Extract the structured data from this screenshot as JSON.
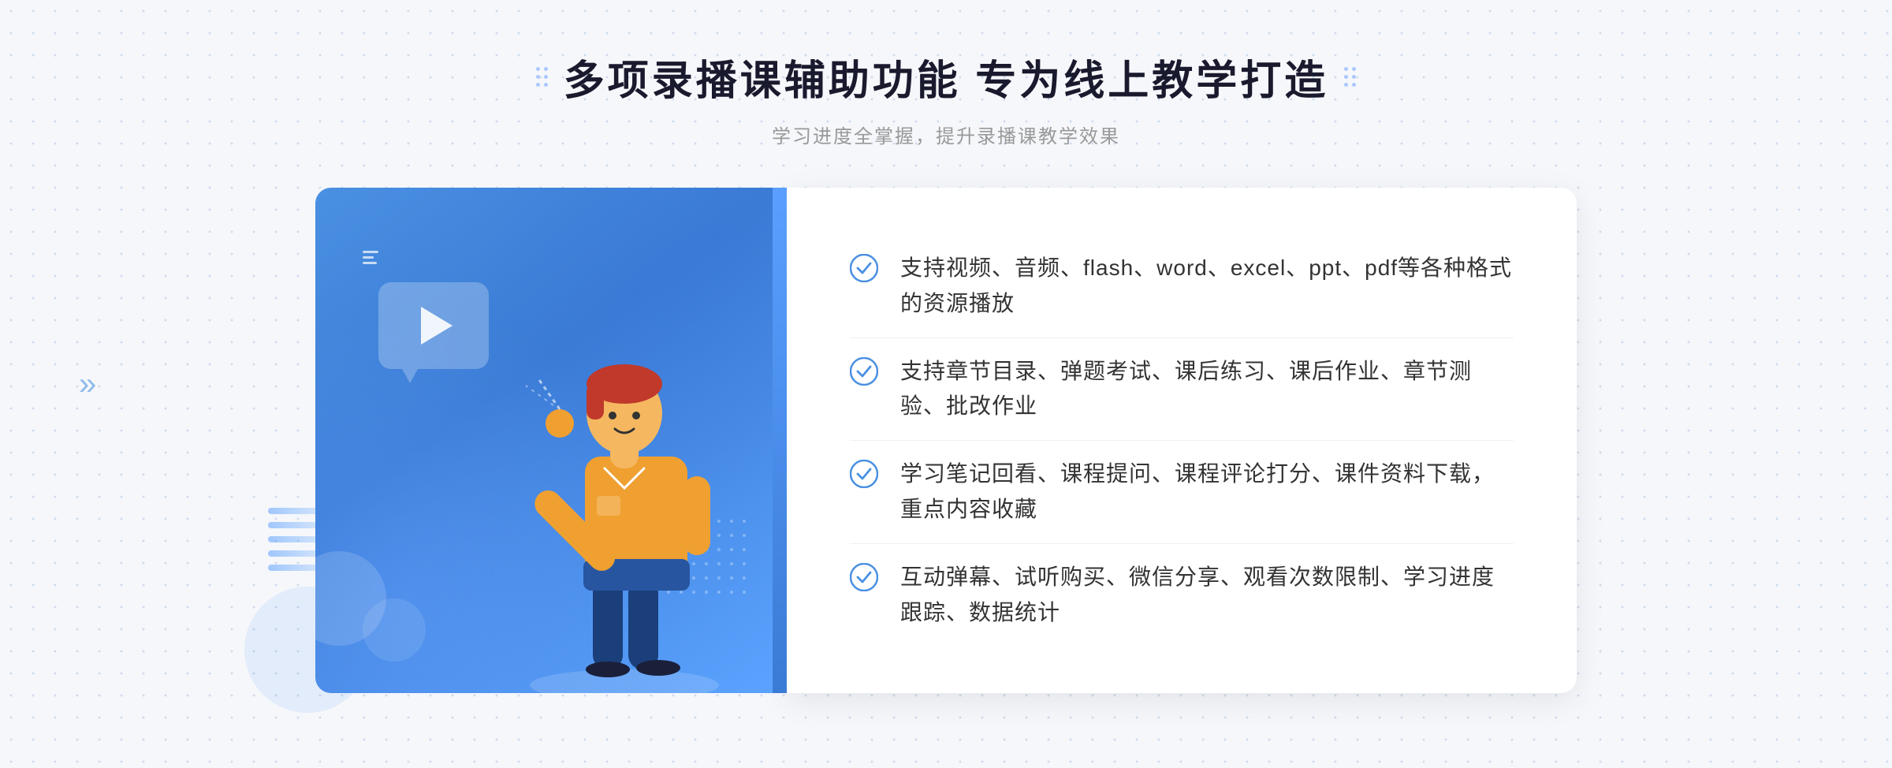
{
  "header": {
    "title": "多项录播课辅助功能 专为线上教学打造",
    "subtitle": "学习进度全掌握，提升录播课教学效果",
    "title_dots_aria": "decorative dots"
  },
  "features": [
    {
      "id": 1,
      "text": "支持视频、音频、flash、word、excel、ppt、pdf等各种格式的资源播放"
    },
    {
      "id": 2,
      "text": "支持章节目录、弹题考试、课后练习、课后作业、章节测验、批改作业"
    },
    {
      "id": 3,
      "text": "学习笔记回看、课程提问、课程评论打分、课件资料下载，重点内容收藏"
    },
    {
      "id": 4,
      "text": "互动弹幕、试听购买、微信分享、观看次数限制、学习进度跟踪、数据统计"
    }
  ],
  "colors": {
    "primary_blue": "#4a90e2",
    "light_blue": "#5ba3ff",
    "text_dark": "#333333",
    "text_gray": "#999999",
    "check_color": "#4a90e2"
  }
}
